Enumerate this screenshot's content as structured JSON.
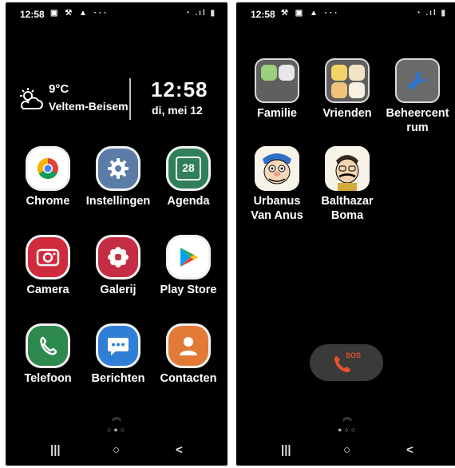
{
  "left_screen": {
    "status": {
      "time": "12:58",
      "icons_left": "▣ ⚒ ▲ ···",
      "icons_right": "◔ .ıl ▮"
    },
    "weather": {
      "temperature": "9°C",
      "location": "Veltem-Beisem"
    },
    "clock": {
      "time": "12:58",
      "date": "di, mei 12"
    },
    "apps": [
      {
        "label": "Chrome",
        "icon": "chrome-icon",
        "color": "#ffffff"
      },
      {
        "label": "Instellingen",
        "icon": "gear-icon",
        "color": "#5b7ca6"
      },
      {
        "label": "Agenda",
        "icon": "calendar-icon",
        "color": "#2f7f5b",
        "icon_text": "28"
      },
      {
        "label": "Camera",
        "icon": "camera-icon",
        "color": "#d12a3c"
      },
      {
        "label": "Galerij",
        "icon": "flower-icon",
        "color": "#c42d44"
      },
      {
        "label": "Play Store",
        "icon": "play-store-icon",
        "color": "#ffffff"
      },
      {
        "label": "Telefoon",
        "icon": "phone-icon",
        "color": "#2d8a4e"
      },
      {
        "label": "Berichten",
        "icon": "message-icon",
        "color": "#2f7fd6"
      },
      {
        "label": "Contacten",
        "icon": "contact-icon",
        "color": "#e27a35"
      }
    ],
    "page_indicator": "○●○"
  },
  "right_screen": {
    "status": {
      "time": "12:58",
      "icons_left": "⚒ ▣ ▲ ···",
      "icons_right": "◔ .ıl ▮"
    },
    "apps": [
      {
        "label": "Familie",
        "icon": "folder-icon"
      },
      {
        "label": "Vrienden",
        "icon": "folder-icon"
      },
      {
        "label": "Beheercentrum",
        "label_line1": "Beheercent",
        "label_line2": "rum",
        "icon": "wrench-icon",
        "color": "#2f73c9"
      },
      {
        "label_line1": "Urbanus",
        "label_line2": "Van Anus",
        "icon": "contact-photo-icon"
      },
      {
        "label_line1": "Balthazar",
        "label_line2": "Boma",
        "icon": "contact-photo-icon"
      }
    ],
    "sos": {
      "label": "SOS",
      "icon": "phone-icon",
      "color": "#e5502e"
    },
    "page_indicator": "●○○"
  },
  "navbar": {
    "recents": "|||",
    "home": "○",
    "back": "<"
  }
}
